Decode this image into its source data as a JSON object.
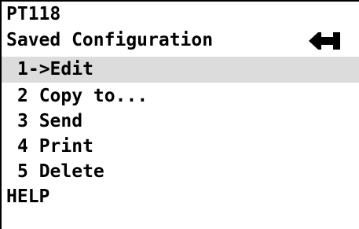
{
  "header": {
    "device": "PT118",
    "menu_title": "Saved Configuration"
  },
  "menu": {
    "items": [
      {
        "label": "1->Edit"
      },
      {
        "label": "2 Copy to..."
      },
      {
        "label": "3 Send"
      },
      {
        "label": "4 Print"
      },
      {
        "label": "5 Delete"
      }
    ]
  },
  "footer": {
    "help": "HELP"
  },
  "icons": {
    "back": "return-arrow-icon"
  }
}
